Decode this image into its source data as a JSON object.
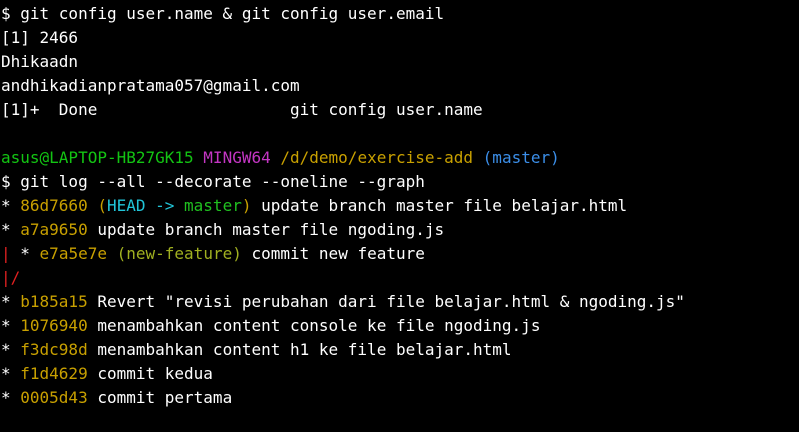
{
  "colors": {
    "background": "#000000",
    "foreground": "#ffffff",
    "prompt_user": "#13c413",
    "prompt_env": "#c436c4",
    "prompt_path": "#c8a000",
    "prompt_branch": "#3b8ee8",
    "commit_hash": "#c8a000",
    "head_ref": "#21c5d8",
    "branch_ref": "#20c020",
    "feature_ref": "#a0b020",
    "graph_red": "#e02020"
  },
  "output1": {
    "cmd_line": "$ git config user.name & git config user.email",
    "job_line": "[1] 2466",
    "user_name": "Dhikaadn",
    "user_email": "andhikadianpratama057@gmail.com",
    "done_line": "[1]+  Done                    git config user.name"
  },
  "prompt": {
    "user_host": "asus@LAPTOP-HB27GK15",
    "env": "MINGW64",
    "path": "/d/demo/exercise-add",
    "branch": "(master)"
  },
  "log_cmd": "$ git log --all --decorate --oneline --graph",
  "log": [
    {
      "graph": "* ",
      "hash": "86d7660",
      "refs_open": " (",
      "head": "HEAD -> ",
      "branch": "master",
      "refs_close": ")",
      "message": " update branch master file belajar.html"
    },
    {
      "graph": "* ",
      "hash": "a7a9650",
      "message": " update branch master file ngoding.js"
    },
    {
      "graph_bar": "|",
      "graph": " * ",
      "hash": "e7a5e7e",
      "refs_open": " (",
      "feature": "new-feature",
      "refs_close": ")",
      "message": " commit new feature"
    },
    {
      "graph_merge": "|/"
    },
    {
      "graph": "* ",
      "hash": "b185a15",
      "message": " Revert \"revisi perubahan dari file belajar.html & ngoding.js\""
    },
    {
      "graph": "* ",
      "hash": "1076940",
      "message": " menambahkan content console ke file ngoding.js"
    },
    {
      "graph": "* ",
      "hash": "f3dc98d",
      "message": " menambahkan content h1 ke file belajar.html"
    },
    {
      "graph": "* ",
      "hash": "f1d4629",
      "message": " commit kedua"
    },
    {
      "graph": "* ",
      "hash": "0005d43",
      "message": " commit pertama"
    }
  ]
}
